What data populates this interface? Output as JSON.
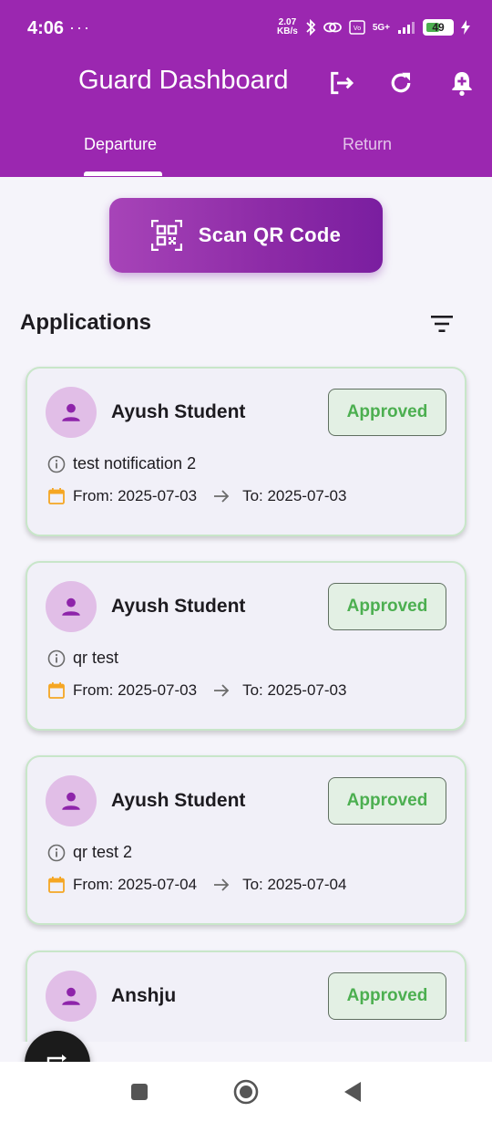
{
  "status_bar": {
    "time": "4:06",
    "extra": "···",
    "net_speed_value": "2.07",
    "net_speed_unit": "KB/s",
    "network": "5G+",
    "battery": "49"
  },
  "header": {
    "title": "Guard Dashboard",
    "actions": [
      "logout-icon",
      "refresh-icon",
      "add-notification-icon"
    ],
    "tabs": [
      {
        "label": "Departure",
        "active": true
      },
      {
        "label": "Return",
        "active": false
      }
    ]
  },
  "scan_button": {
    "label": "Scan QR Code",
    "icon": "qr-scan-icon"
  },
  "applications": {
    "title": "Applications",
    "filter_icon": "filter-icon",
    "items": [
      {
        "name": "Ayush Student",
        "status": "Approved",
        "reason": "test notification 2",
        "from": "From: 2025-07-03",
        "to": "To: 2025-07-03"
      },
      {
        "name": "Ayush Student",
        "status": "Approved",
        "reason": "qr test",
        "from": "From: 2025-07-03",
        "to": "To: 2025-07-03"
      },
      {
        "name": "Ayush Student",
        "status": "Approved",
        "reason": "qr test 2",
        "from": "From: 2025-07-04",
        "to": "To: 2025-07-04"
      },
      {
        "name": "Anshju",
        "status": "Approved",
        "reason": "",
        "from": "",
        "to": ""
      }
    ]
  },
  "colors": {
    "primary": "#9b27b0",
    "approved_text": "#4caf50",
    "approved_bg": "#e3f0e4",
    "card_border": "#c8e6c9",
    "avatar_bg": "#e1bee7",
    "calendar": "#f5a623"
  },
  "fab_icon": "switch-icon",
  "nav_bar": [
    "square-icon",
    "home-circle-icon",
    "back-triangle-icon"
  ]
}
